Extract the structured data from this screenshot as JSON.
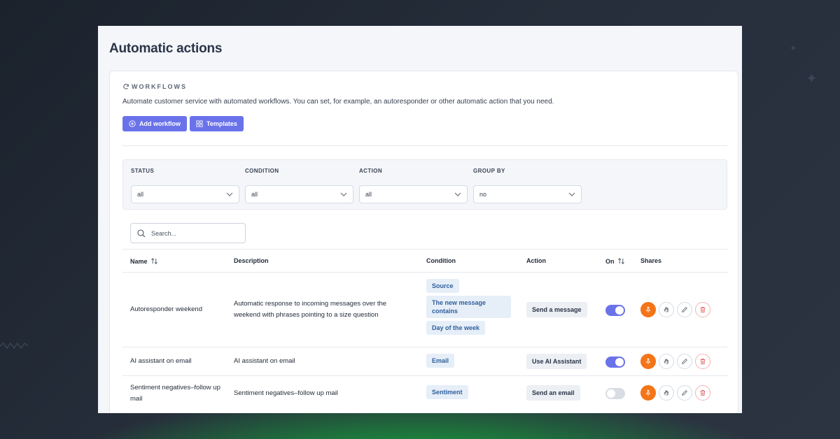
{
  "page": {
    "title": "Automatic actions"
  },
  "section": {
    "heading": "WORKFLOWS",
    "description": "Automate customer service with automated workflows. You can set, for example, an autoresponder or other automatic action that you need.",
    "add_label": "Add workflow",
    "templates_label": "Templates"
  },
  "filters": [
    {
      "label": "STATUS",
      "value": "all"
    },
    {
      "label": "CONDITION",
      "value": "all"
    },
    {
      "label": "ACTION",
      "value": "all"
    },
    {
      "label": "GROUP BY",
      "value": "no"
    }
  ],
  "search": {
    "placeholder": "Search..."
  },
  "table": {
    "headers": {
      "name": "Name",
      "description": "Description",
      "condition": "Condition",
      "action": "Action",
      "on": "On",
      "shares": "Shares"
    },
    "rows": [
      {
        "name": "Autoresponder weekend",
        "description": "Automatic response to incoming messages over the weekend with phrases pointing to a size question",
        "conditions": [
          "Source",
          "The new message contains",
          "Day of the week"
        ],
        "action": "Send a message",
        "on": true
      },
      {
        "name": "AI assistant on email",
        "description": "AI assistant on email",
        "conditions": [
          "Email"
        ],
        "action": "Use AI Assistant",
        "on": true
      },
      {
        "name": "Sentiment negatives–follow up mail",
        "description": "Sentiment negatives–follow up mail",
        "conditions": [
          "Sentiment"
        ],
        "action": "Send an email",
        "on": false
      }
    ]
  },
  "colors": {
    "accent": "#6a72ea",
    "pin": "#f47418",
    "chip_bg": "#e6eef8",
    "chip_text": "#2f5f9c",
    "delete": "#e05252"
  },
  "icons": [
    "refresh-icon",
    "plus-circle-icon",
    "grid-icon",
    "chevron-down-icon",
    "search-icon",
    "sort-icon",
    "pin-icon",
    "hand-icon",
    "pencil-icon",
    "trash-icon"
  ]
}
